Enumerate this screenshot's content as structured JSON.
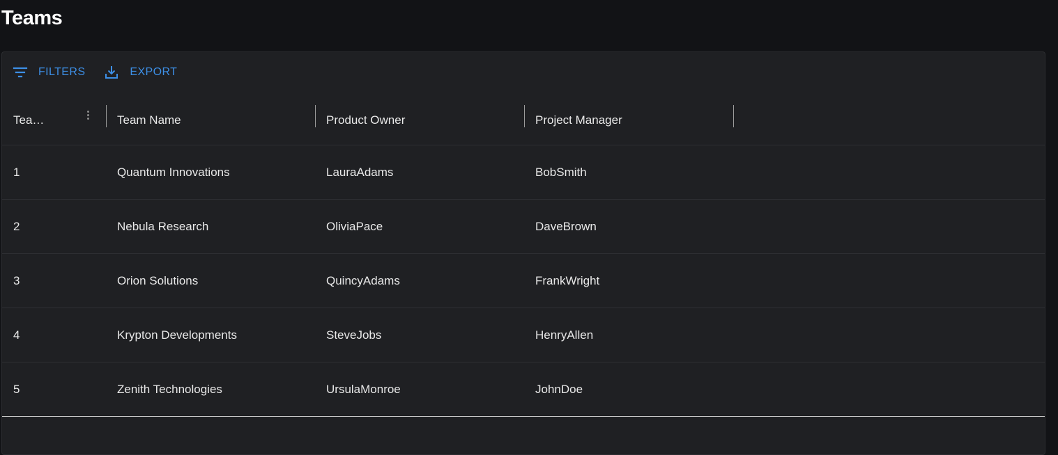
{
  "page": {
    "title": "Teams"
  },
  "toolbar": {
    "filters_label": "FILTERS",
    "export_label": "EXPORT"
  },
  "table": {
    "columns": [
      "Tea…",
      "Team Name",
      "Product Owner",
      "Project Manager"
    ],
    "rows": [
      [
        "1",
        "Quantum Innovations",
        "LauraAdams",
        "BobSmith"
      ],
      [
        "2",
        "Nebula Research",
        "OliviaPace",
        "DaveBrown"
      ],
      [
        "3",
        "Orion Solutions",
        "QuincyAdams",
        "FrankWright"
      ],
      [
        "4",
        "Krypton Developments",
        "SteveJobs",
        "HenryAllen"
      ],
      [
        "5",
        "Zenith Technologies",
        "UrsulaMonroe",
        "JohnDoe"
      ]
    ]
  },
  "colors": {
    "accent": "#3d8fe6",
    "background": "#121316",
    "panel": "#1f2023"
  }
}
